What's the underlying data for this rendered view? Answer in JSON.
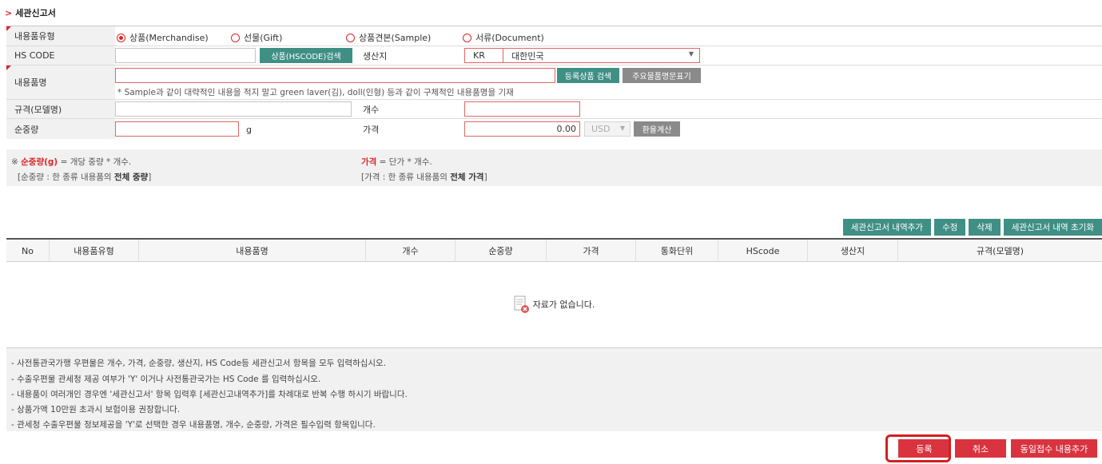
{
  "section_title": "세관신고서",
  "form": {
    "content_type": {
      "label": "내용품유형",
      "options": [
        "상품(Merchandise)",
        "선물(Gift)",
        "상품견본(Sample)",
        "서류(Document)"
      ],
      "selected": "상품(Merchandise)"
    },
    "hs_code": {
      "label": "HS CODE",
      "value": "",
      "search_button": "상품(HSCODE)검색"
    },
    "origin": {
      "label": "생산지",
      "code": "KR",
      "country": "대한민국"
    },
    "item_name": {
      "label": "내용품명",
      "value": "",
      "registered_search_button": "등록상품 검색",
      "major_items_button": "주요물품명문표기",
      "hint": "* Sample과 같이 대략적인 내용을 적지 말고 green laver(김), doll(인형) 등과 같이 구체적인 내용품명을 기재"
    },
    "spec": {
      "label": "규격(모델명)",
      "value": ""
    },
    "count": {
      "label": "개수",
      "value": ""
    },
    "net_weight": {
      "label": "순중량",
      "value": "",
      "unit": "g"
    },
    "price": {
      "label": "가격",
      "value": "0.00",
      "currency": "USD",
      "calc_button": "환율계산"
    }
  },
  "notes": {
    "weight_prefix": "※ ",
    "weight_key": "순중량(g)",
    "weight_formula": " = 개당 중량 * 개수.",
    "weight_detail_a": "[순중량 : 한 종류 내용품의 ",
    "weight_detail_b": "전체 중량",
    "weight_detail_c": "]",
    "price_key": "가격",
    "price_formula": " = 단가 * 개수.",
    "price_detail_a": "[가격 : 한 종류 내용품의 ",
    "price_detail_b": "전체 가격",
    "price_detail_c": "]"
  },
  "list_buttons": [
    "세관신고서 내역추가",
    "수정",
    "삭제",
    "세관신고서 내역 초기화"
  ],
  "table": {
    "columns": [
      "No",
      "내용품유형",
      "내용품명",
      "개수",
      "순중량",
      "가격",
      "통화단위",
      "HScode",
      "생산지",
      "규격(모델명)"
    ],
    "rows": [],
    "empty_message": "자료가 없습니다."
  },
  "guide_lines": [
    "- 사전통관국가행 우편물은 개수, 가격, 순중량, 생산지, HS Code등 세관신고서 항목을 모두 입력하십시오.",
    "- 수출우편물 관세청 제공 여부가 'Y' 이거나 사전통관국가는 HS Code 를  입력하십시오.",
    "- 내용품이 여러개인 경우엔 '세관신고서' 항목 입력후 [세관신고내역추가]를 차례대로 반복 수행 하시기 바랍니다.",
    "- 상품가액 10만원 초과시 보험이용 권장합니다.",
    "- 관세청 수출우편물 정보제공을 'Y'로 선택한 경우 내용품명, 개수, 순중량, 가격은 필수입력 항목입니다."
  ],
  "bottom_buttons": {
    "register": "등록",
    "cancel": "취소",
    "same_day_add": "동일접수 내용추가"
  },
  "colors": {
    "accent_red": "#d9333f",
    "teal": "#3f8f85",
    "highlight": "#d41f1f"
  }
}
